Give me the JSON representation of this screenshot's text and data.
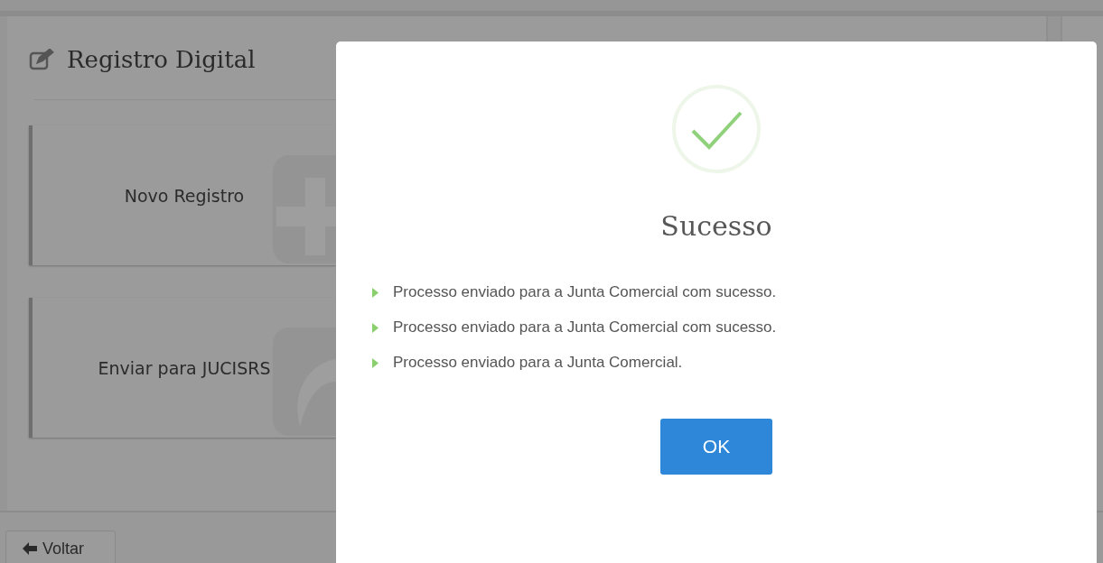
{
  "page": {
    "title": "Registro Digital",
    "actions": [
      {
        "label": "Novo Registro",
        "kind": "add"
      },
      {
        "label": "Enviar para JUCISRS",
        "kind": "send"
      }
    ],
    "back_button": "Voltar"
  },
  "dialog": {
    "title": "Sucesso",
    "messages": [
      "Processo enviado para a Junta Comercial com sucesso.",
      "Processo enviado para a Junta Comercial com sucesso.",
      "Processo enviado para a Junta Comercial."
    ],
    "button": "OK"
  }
}
